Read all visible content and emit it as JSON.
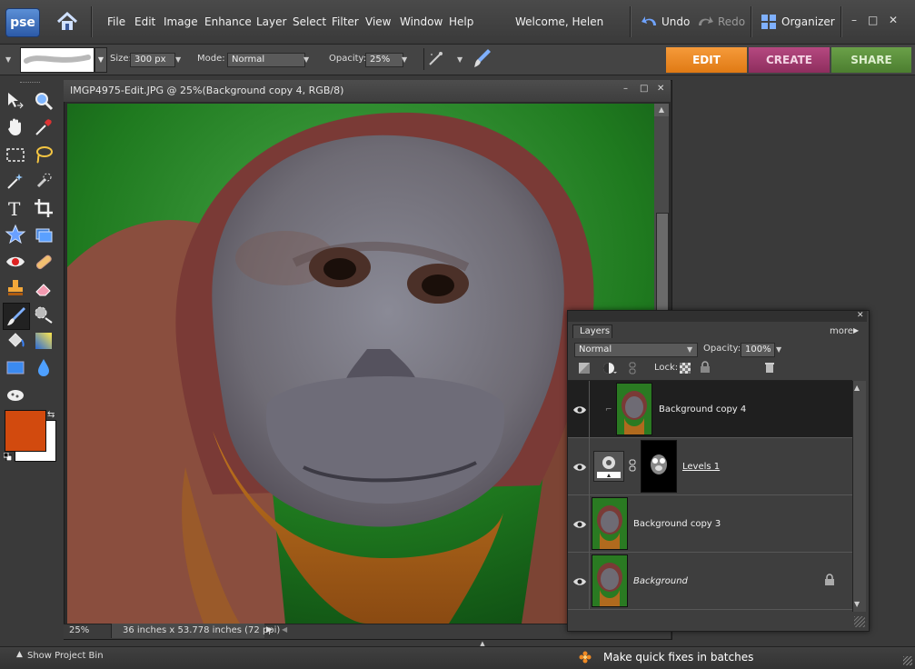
{
  "app": {
    "logo": "pse",
    "welcome": "Welcome, Helen"
  },
  "menu": [
    "File",
    "Edit",
    "Image",
    "Enhance",
    "Layer",
    "Select",
    "Filter",
    "View",
    "Window",
    "Help"
  ],
  "toolbar_right": {
    "undo": "Undo",
    "redo": "Redo",
    "organizer": "Organizer"
  },
  "window_controls": {
    "minimize": "–",
    "maximize": "□",
    "close": "✕"
  },
  "options": {
    "size_label": "Size:",
    "size_value": "300 px",
    "mode_label": "Mode:",
    "mode_value": "Normal",
    "opacity_label": "Opacity:",
    "opacity_value": "25%"
  },
  "mode_tabs": [
    {
      "label": "EDIT",
      "color": "#e8821a",
      "active": true
    },
    {
      "label": "CREATE",
      "color": "#a33a6e",
      "active": false
    },
    {
      "label": "SHARE",
      "color": "#5c8f3a",
      "active": false
    }
  ],
  "document": {
    "title": "IMGP4975-Edit.JPG @ 25%(Background copy 4, RGB/8)",
    "zoom": "25%",
    "dimensions": "36 inches x 53.778 inches (72 ppi)"
  },
  "colors": {
    "foreground": "#d24a0e",
    "background": "#ffffff",
    "accent": "#e8821a"
  },
  "layers_panel": {
    "tab": "Layers",
    "more": "more",
    "blend_mode": "Normal",
    "opacity_label": "Opacity:",
    "opacity_value": "100%",
    "lock_label": "Lock:",
    "layers": [
      {
        "name": "Background copy 4",
        "selected": true,
        "italic": false,
        "underline": false,
        "type": "image"
      },
      {
        "name": "Levels 1",
        "selected": false,
        "italic": false,
        "underline": true,
        "type": "adjustment"
      },
      {
        "name": "Background copy 3",
        "selected": false,
        "italic": false,
        "underline": false,
        "type": "image"
      },
      {
        "name": "Background",
        "selected": false,
        "italic": true,
        "underline": false,
        "type": "image",
        "locked": true
      }
    ]
  },
  "bottom": {
    "project_bin": "Show Project Bin",
    "tip": "Make quick fixes in batches"
  },
  "icons": [
    "home-icon",
    "undo-icon",
    "redo-icon",
    "organizer-icon",
    "brush-icon",
    "airbrush-icon",
    "move-icon",
    "zoom-icon",
    "hand-icon",
    "eyedropper-icon",
    "marquee-icon",
    "lasso-icon",
    "magic-wand-icon",
    "quick-selection-icon",
    "type-icon",
    "crop-icon",
    "cookie-cutter-icon",
    "straighten-icon",
    "red-eye-icon",
    "healing-brush-icon",
    "clone-stamp-icon",
    "eraser-icon",
    "paint-brush-icon",
    "smart-brush-icon",
    "paint-bucket-icon",
    "gradient-icon",
    "shape-icon",
    "blur-icon",
    "sponge-icon",
    "eye-icon",
    "lock-icon",
    "trash-icon",
    "new-layer-icon",
    "adjustment-icon",
    "link-icon",
    "flower-icon"
  ]
}
